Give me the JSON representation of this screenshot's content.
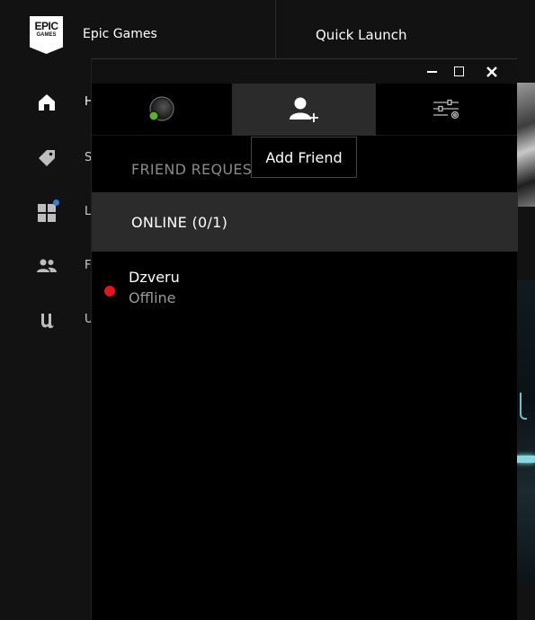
{
  "app": {
    "logo_line1": "EPIC",
    "logo_line2": "GAMES",
    "brand_name": "Epic Games",
    "quick_launch": "Quick Launch"
  },
  "sidebar": {
    "items": [
      {
        "icon": "home-icon",
        "label": "H"
      },
      {
        "icon": "tag-icon",
        "label": "S"
      },
      {
        "icon": "grid-icon",
        "label": "L",
        "badge": true
      },
      {
        "icon": "friends-icon",
        "label": "F"
      },
      {
        "icon": "unreal-icon",
        "label": "U"
      }
    ]
  },
  "friends_panel": {
    "window_controls": {
      "minimize": "minimize-icon",
      "maximize": "maximize-icon",
      "close": "close-icon"
    },
    "tabs": [
      {
        "id": "status",
        "icon": "presence-icon"
      },
      {
        "id": "add_friend",
        "icon": "add-friend-icon",
        "active": true
      },
      {
        "id": "settings",
        "icon": "settings-sliders-icon"
      }
    ],
    "tooltip": "Add Friend",
    "friend_requests_label": "FRIEND REQUES",
    "online_header": "ONLINE (0/1)",
    "friends": [
      {
        "name": "Dzveru",
        "status": "Offline",
        "status_color": "#e5141a"
      }
    ]
  },
  "colors": {
    "background": "#121212",
    "panel": "#000000",
    "active_tab": "#2b2b2b",
    "presence_online": "#5ab22b",
    "offline": "#e5141a",
    "badge": "#2f7fd6"
  }
}
